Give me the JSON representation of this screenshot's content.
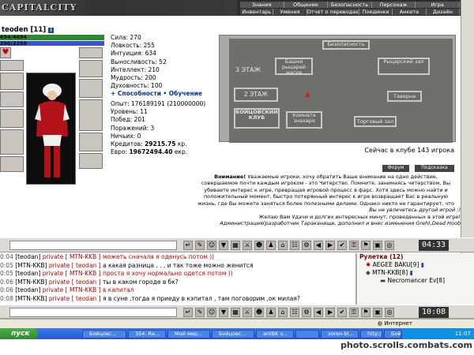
{
  "app": {
    "logo": "CAPITALCITY"
  },
  "menu": {
    "row1": [
      "Знания",
      "Общение",
      "Безопасность",
      "Персонаж",
      "Игра"
    ],
    "row2": [
      "Инвентарь",
      "Умения",
      "Отчет о переводах",
      "Поединки",
      "Анкета",
      "Дизайн"
    ]
  },
  "character": {
    "name": "teoden",
    "level": "[11]",
    "hp": "694/4694",
    "mp": "250/2250"
  },
  "stats": [
    "Сила: 270",
    "Ловкость: 255",
    "Интуиция: 634",
    "Выносливость: 52",
    "Интеллект: 210",
    "Мудрость: 200",
    "Духовность: 100"
  ],
  "links": {
    "abilities": "+ Способности",
    "training": "• Обучение"
  },
  "info": [
    "Опыт: 176189191 (210000000)",
    "Уровень: 11",
    "Побед: 201",
    "Поражений: 3",
    "Ничьих: 0"
  ],
  "credits_label": "Кредитов:",
  "credits_value": "29215.75",
  "credits_unit": "кр.",
  "euro_label": "Евро:",
  "euro_value": "19672494.40",
  "euro_unit": "екр.",
  "map": {
    "rooms": [
      "Башня рыцарей магов",
      "Рыцарский зал",
      "3 ЭТАЖ",
      "Безопасность",
      "2 ЭТАЖ",
      "Таверна",
      "БОЙЦОВСКИЙ КЛУБ",
      "Комната знахаря",
      "Торговый зал"
    ]
  },
  "club_status": "Сейчас в клубе 143 игрока",
  "buttons": {
    "forum": "Форум",
    "hint": "Подсказка"
  },
  "notice": {
    "title": "Внимание!",
    "text1": "Уважаемые игроки, хочу обратить Ваше внимание на одно действие,",
    "text2": "совершаемое почти каждым игроком - это Читерство. Помните, занимаясь читерством, Вы",
    "text3": "убиваете интерес к игре, превращая игровой процесс в фарс. Хотя здесь можно найти и",
    "text4": "положительный момент, быстро потерянный интерес к игре возвращает Вас в реальную",
    "text5": "жизнь, где Вы можете заняться более полезными делами. Однако никто не гарантирует, что",
    "text6": "Вы не увлечетесь другой игрой :)",
    "text7": "Желаю Вам Удачи и долгих интересных минут, проведенных в этой игре!",
    "text8": "Администрация(разработчик Тараканище, дополнил и внес изменения Greh),Dead Hoob"
  },
  "clock1": "04:33",
  "chat": [
    {
      "time": "0:04",
      "from": "[teodan]",
      "private": "private [ MTN-KKB ]",
      "msg": "можеть сначала я оденусь потом ))"
    },
    {
      "time": "0:05",
      "from": "[MTN-KKB]",
      "private": "private [ teodan ]",
      "msg": "а какая разница . . , и так тоже можно женится"
    },
    {
      "time": "0:05",
      "from": "[teodan]",
      "private": "private [ MTN-KKB ]",
      "msg": "проста я хочу нормально одется потом ))"
    },
    {
      "time": "0:06",
      "from": "[MTN-KKB]",
      "private": "private [ teodan ]",
      "msg": "ты в каком городе в бк?"
    },
    {
      "time": "0:06",
      "from": "[teodan]",
      "private": "private [ MTN-KKB ]",
      "msg": "в капитал"
    },
    {
      "time": "0:08",
      "from": "[MTN-KKB]",
      "private": "private [ teodan ]",
      "msg": "я в суне ,тогда я приеду в кэпитал , там поговорим ,ок милая?"
    }
  ],
  "users": {
    "title": "Рулетка (12)",
    "list": [
      "AEGEE BAKU[9]",
      "MTN-KKB[8]",
      "Necromancer Ev[8]"
    ]
  },
  "clock2": "10:08",
  "status": "Интернет",
  "taskbar": {
    "start": "пуск",
    "tasks": [
      "Бойцовс...",
      "354. Ra...",
      "Мой мир...",
      "Бойцовс...",
      "antBK v...",
      "",
      "xoren-bl...",
      "http://w...",
      "Бойцовс..."
    ],
    "time": "11:07"
  },
  "watermark": "photo.scrolls.combats.com"
}
